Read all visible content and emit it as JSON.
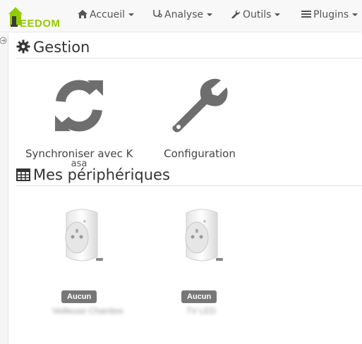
{
  "navbar": {
    "logo_text": "EEDOM",
    "items": [
      {
        "label": "Accueil",
        "icon": "home-icon"
      },
      {
        "label": "Analyse",
        "icon": "stethoscope-icon"
      },
      {
        "label": "Outils",
        "icon": "wrench-icon"
      },
      {
        "label": "Plugins",
        "icon": "list-icon"
      }
    ]
  },
  "gestion": {
    "title": "Gestion",
    "cards": [
      {
        "label": "Synchroniser avec K",
        "label_overflow": "asa",
        "icon": "sync-icon"
      },
      {
        "label": "Configuration",
        "icon": "wrench-icon"
      }
    ]
  },
  "devices": {
    "title": "Mes périphériques",
    "items": [
      {
        "badge": "Aucun",
        "name": "Veilleuse Chambre"
      },
      {
        "badge": "Aucun",
        "name": "TV LED"
      }
    ]
  },
  "colors": {
    "brand": "#94ca02",
    "badge": "#777777",
    "icon": "#6e6e6e"
  }
}
